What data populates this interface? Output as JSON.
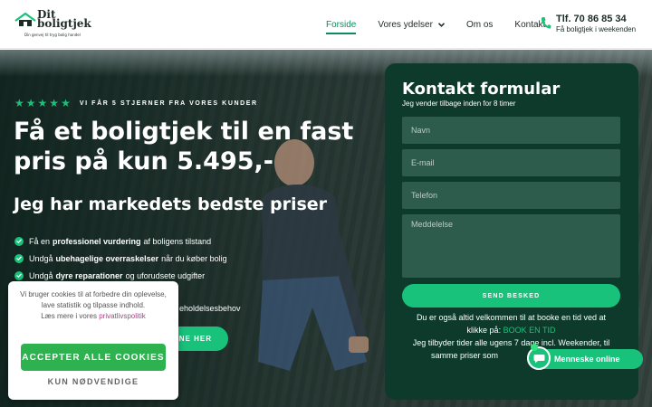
{
  "header": {
    "logo": {
      "line1": "Dit",
      "line2": "boligtjek",
      "tagline": "Din genvej til tryg bolig handel"
    },
    "nav": [
      {
        "label": "Forside",
        "active": true
      },
      {
        "label": "Vores ydelser",
        "active": false,
        "dropdown": true
      },
      {
        "label": "Om os",
        "active": false
      },
      {
        "label": "Kontakt",
        "active": false
      }
    ],
    "phone": {
      "number": "Tlf. 70 86 85 34",
      "subtitle": "Få boligtjek i weekenden",
      "icon": "phone-icon"
    }
  },
  "hero": {
    "stars": 5,
    "stars_label": "VI FÅR 5 STJERNER FRA VORES KUNDER",
    "headline": "Få et boligtjek til en fast pris på kun 5.495,-",
    "subheadline": "Jeg har markedets bedste priser",
    "bullets": [
      {
        "pre": "Få en",
        "bold": "professionel vurdering",
        "post": "af boligens tilstand"
      },
      {
        "pre": "Undgå",
        "bold": "ubehagelige overraskelser",
        "post": "når du køber bolig"
      },
      {
        "pre": "Undgå",
        "bold": "dyre reparationer",
        "post": "og uforudsete udgifter"
      }
    ],
    "bullet_partial": "eholdelsesbehov",
    "cta_label": "ONE HER"
  },
  "contact_form": {
    "title": "Kontakt formular",
    "subtitle": "Jeg vender tilbage inden for 8 timer",
    "fields": {
      "name": "Navn",
      "email": "E-mail",
      "phone": "Telefon",
      "message": "Meddelelse"
    },
    "submit_label": "SEND BESKED",
    "note_line1": "Du er også altid velkommen til at booke en tid ved at",
    "note_line2_pre": "klikke på:",
    "note_link": "BOOK EN TID",
    "note_line3": "Jeg tilbyder tider alle ugens 7 dage incl. Weekender, til",
    "note_line4": "samme priser som"
  },
  "chat": {
    "label": "Menneske online",
    "icon": "chat-bubble-icon"
  },
  "cookie": {
    "line1": "Vi bruger cookies til at forbedre din oplevelse,",
    "line2": "lave statistik og tilpasse indhold.",
    "line3_pre": "Læs mere i vores",
    "privacy_link": "privatlivspolitik",
    "accept_label": "ACCEPTER ALLE COOKIES",
    "necessary_label": "KUN NØDVENDIGE"
  },
  "colors": {
    "brand_green": "#19c27b",
    "form_bg": "#0e3a2b",
    "field_bg": "#2d5c4c",
    "cookie_accept": "#2eb24f"
  }
}
